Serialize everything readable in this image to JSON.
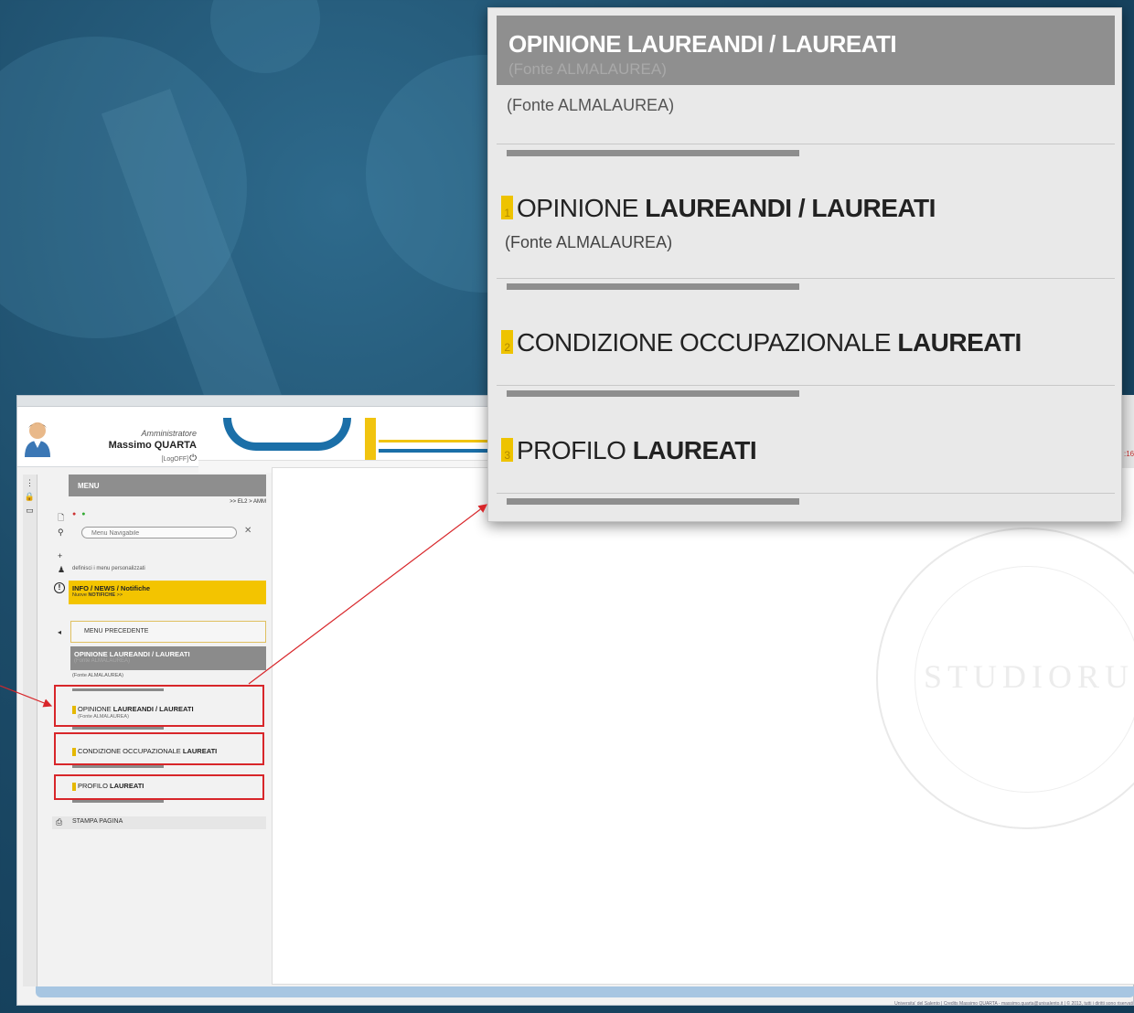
{
  "header": {
    "user_role": "Amministratore",
    "user_name": "Massimo QUARTA",
    "logoff_label": "[LogOFF]"
  },
  "sidebar": {
    "menu_title": "MENU",
    "menu_path": ">> EL2 > AMM",
    "search_placeholder": "Menu Navigabile",
    "personal_menu_link": "definisci i menu personalizzati",
    "info": {
      "title": "INFO / NEWS / Notifiche",
      "sub_prefix": "Nuove",
      "sub_bold": "NOTIFICHE",
      "sub_suffix": ">>"
    },
    "prev_menu": "MENU PRECEDENTE",
    "section_title": "OPINIONE LAUREANDI / LAUREATI",
    "section_sub": "(Fonte ALMALAUREA)",
    "section_source": "(Fonte ALMALAUREA)",
    "items": [
      {
        "num": "1",
        "pre": "OPINIONE ",
        "bold": "LAUREANDI / LAUREATI",
        "source": "(Fonte ALMALAUREA)"
      },
      {
        "num": "2",
        "pre": "CONDIZIONE OCCUPAZIONALE ",
        "bold": "LAUREATI"
      },
      {
        "num": "3",
        "pre": "PROFILO ",
        "bold": "LAUREATI"
      }
    ],
    "print_label": "STAMPA PAGINA"
  },
  "popup": {
    "title": "OPINIONE LAUREANDI / LAUREATI",
    "title_sub": "(Fonte ALMALAUREA)",
    "source": "(Fonte ALMALAUREA)",
    "items": [
      {
        "num": "1",
        "pre": "OPINIONE ",
        "bold": "LAUREANDI / LAUREATI",
        "source": "(Fonte ALMALAUREA)"
      },
      {
        "num": "2",
        "pre": "CONDIZIONE OCCUPAZIONALE ",
        "bold": "LAUREATI"
      },
      {
        "num": "3",
        "pre": "PROFILO ",
        "bold": "LAUREATI"
      }
    ]
  },
  "main": {
    "seal_text": "STUDIORU"
  },
  "footer": {
    "text": "Universita' del Salento | Credits Massimo QUARTA - massimo.quarta@unisalento.it | © 2013, tutti i diritti sono riservati"
  },
  "colors": {
    "accent_yellow": "#f3c400",
    "highlight_red": "#d8262a",
    "header_gray": "#8f8f8f",
    "brand_blue": "#1b6fa8"
  }
}
